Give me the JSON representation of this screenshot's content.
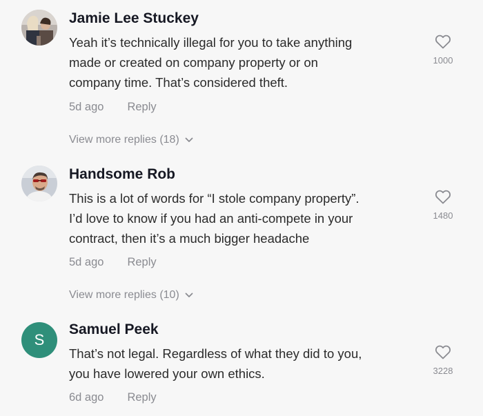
{
  "comments": [
    {
      "username": "Jamie Lee Stuckey",
      "lines": [
        "Yeah it’s technically illegal for you to take anything",
        "made or created on company property or on",
        "company time. That’s considered theft."
      ],
      "time": "5d ago",
      "reply": "Reply",
      "likes": "1000",
      "view_more": "View more replies (18)",
      "avatar_icon": "photo-avatar-icon"
    },
    {
      "username": "Handsome Rob",
      "lines": [
        "This is a lot of words for “I stole company property”.",
        "I’d love to know if you had an anti-compete in your",
        "contract, then it’s a much bigger headache"
      ],
      "time": "5d ago",
      "reply": "Reply",
      "likes": "1480",
      "view_more": "View more replies (10)",
      "avatar_icon": "photo-avatar-icon"
    },
    {
      "username": "Samuel Peek",
      "avatar_initial": "S",
      "lines": [
        "That’s not legal. Regardless of what they did to you,",
        "you have lowered your own ethics."
      ],
      "time": "6d ago",
      "reply": "Reply",
      "likes": "3228"
    }
  ],
  "icons": {
    "like": "heart-outline-icon",
    "expand": "chevron-down-icon"
  },
  "colors": {
    "background": "#f7f7f7",
    "muted_text": "#8a8b91",
    "initial_avatar": "#2f8f7a"
  }
}
